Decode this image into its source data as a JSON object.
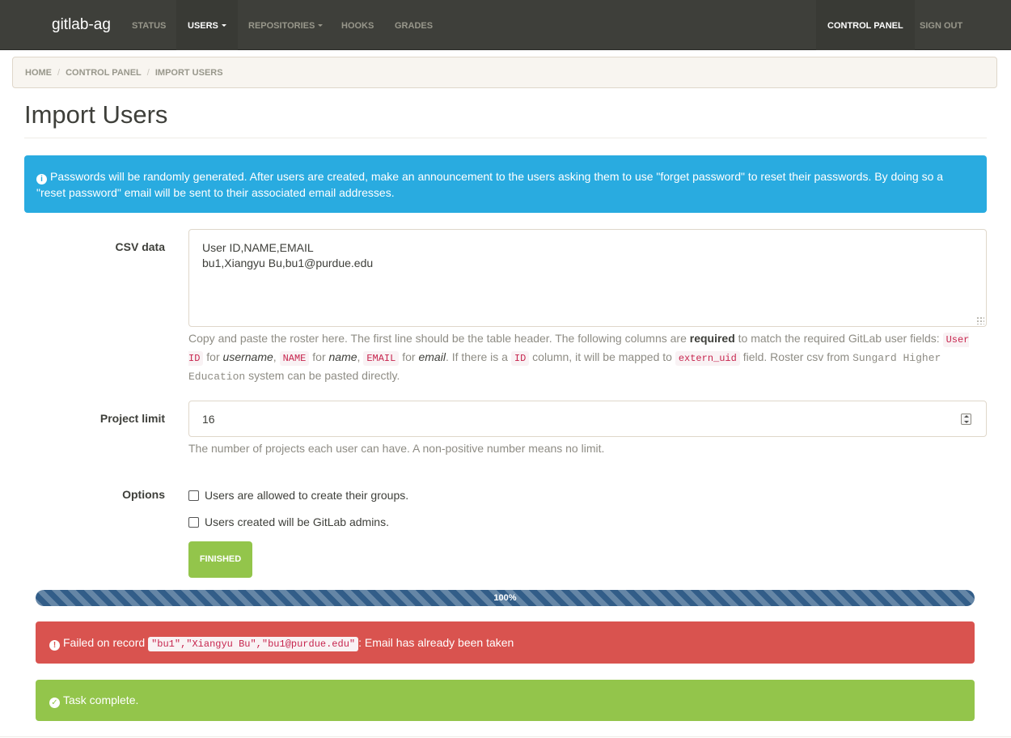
{
  "navbar": {
    "brand": "gitlab-ag",
    "items": [
      {
        "label": "STATUS",
        "dropdown": false,
        "active": false
      },
      {
        "label": "USERS",
        "dropdown": true,
        "active": true
      },
      {
        "label": "REPOSITORIES",
        "dropdown": true,
        "active": false
      },
      {
        "label": "HOOKS",
        "dropdown": false,
        "active": false
      },
      {
        "label": "GRADES",
        "dropdown": false,
        "active": false
      }
    ],
    "right_items": [
      {
        "label": "CONTROL PANEL",
        "active": true
      },
      {
        "label": "SIGN OUT",
        "active": false
      }
    ]
  },
  "breadcrumb": [
    "HOME",
    "CONTROL PANEL",
    "IMPORT USERS"
  ],
  "page_title": "Import Users",
  "info_alert": {
    "icon": "info-circle-icon",
    "text": "Passwords will be randomly generated. After users are created, make an announcement to the users asking them to use \"forget password\" to reset their passwords. By doing so a \"reset password\" email will be sent to their associated email addresses."
  },
  "csv": {
    "label": "CSV data",
    "value": "User ID,NAME,EMAIL\nbu1,Xiangyu Bu,bu1@purdue.edu",
    "help": {
      "p1": "Copy and paste the roster here. The first line should be the table header. The following columns are ",
      "required": "required",
      "p2": " to match the required GitLab user fields: ",
      "code_user_id": "User ID",
      "for1": " for ",
      "username": "username",
      "comma1": ", ",
      "code_name": "NAME",
      "for2": " for ",
      "name": "name",
      "comma2": ", ",
      "code_email": "EMAIL",
      "for3": " for ",
      "email": "email",
      "p3": ". If there is a ",
      "code_id": "ID",
      "p4": " column, it will be mapped to ",
      "code_extern_uid": "extern_uid",
      "p5": " field. Roster csv from ",
      "sungard": "Sungard Higher Education",
      "p6": " system can be pasted directly."
    }
  },
  "project_limit": {
    "label": "Project limit",
    "value": "16",
    "help": "The number of projects each user can have. A non-positive number means no limit."
  },
  "options": {
    "label": "Options",
    "checkboxes": [
      {
        "label": "Users are allowed to create their groups.",
        "checked": false
      },
      {
        "label": "Users created will be GitLab admins.",
        "checked": false
      }
    ]
  },
  "finished_button": "FINISHED",
  "progress": {
    "value": 100,
    "label": "100%"
  },
  "error_alert": {
    "icon": "exclamation-circle-icon",
    "prefix": "Failed on record ",
    "record": "\"bu1\",\"Xiangyu Bu\",\"bu1@purdue.edu\"",
    "suffix": ": Email has already been taken"
  },
  "success_alert": {
    "icon": "check-circle-icon",
    "text": "Task complete."
  },
  "colors": {
    "navbar": "#3e3f3a",
    "info": "#29abe0",
    "danger": "#d9534f",
    "success": "#93c54b",
    "progress": "#325d88"
  }
}
